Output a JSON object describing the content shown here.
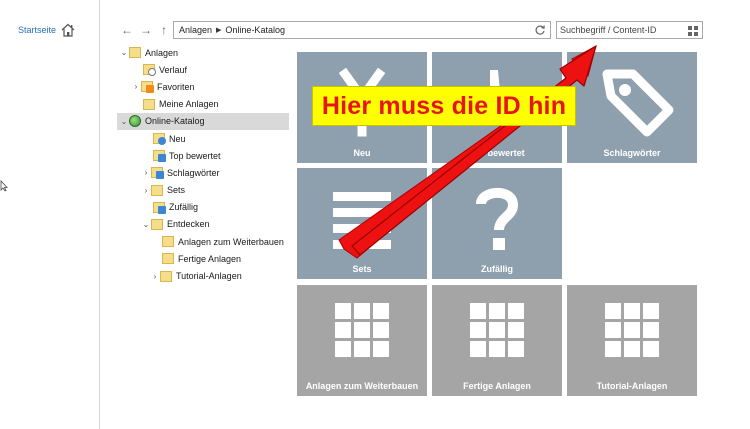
{
  "left_nav": {
    "startseite_label": "Startseite",
    "icon": "home-icon"
  },
  "toolbar": {
    "back": "←",
    "forward": "→",
    "up": "↑",
    "breadcrumb": [
      "Anlagen",
      "Online-Katalog"
    ],
    "search_placeholder": "Suchbegriff / Content-ID"
  },
  "tree": [
    {
      "label": "Anlagen",
      "chevron": "v",
      "icon": "folder-icon"
    },
    {
      "label": "Verlauf",
      "chevron": "",
      "icon": "history-folder-icon"
    },
    {
      "label": "Favoriten",
      "chevron": ">",
      "icon": "favorites-folder-icon"
    },
    {
      "label": "Meine Anlagen",
      "chevron": "",
      "icon": "folder-icon"
    },
    {
      "label": "Online-Katalog",
      "chevron": "v",
      "icon": "globe-icon",
      "selected": true
    },
    {
      "label": "Neu",
      "chevron": "",
      "icon": "new-folder-icon"
    },
    {
      "label": "Top bewertet",
      "chevron": "",
      "icon": "thumbs-up-folder-icon"
    },
    {
      "label": "Schlagwörter",
      "chevron": ">",
      "icon": "tag-folder-icon"
    },
    {
      "label": "Sets",
      "chevron": ">",
      "icon": "folder-icon"
    },
    {
      "label": "Zufällig",
      "chevron": "",
      "icon": "random-folder-icon"
    },
    {
      "label": "Entdecken",
      "chevron": "v",
      "icon": "folder-icon"
    },
    {
      "label": "Anlagen zum Weiterbauen",
      "chevron": "",
      "icon": "folder-icon"
    },
    {
      "label": "Fertige Anlagen",
      "chevron": "",
      "icon": "folder-icon"
    },
    {
      "label": "Tutorial-Anlagen",
      "chevron": ">",
      "icon": "folder-icon"
    }
  ],
  "tiles": [
    {
      "label": "Neu",
      "icon": "sparkle-icon",
      "color": "#8e9fae"
    },
    {
      "label": "Top bewertet",
      "icon": "thumbs-up-icon",
      "color": "#8e9fae"
    },
    {
      "label": "Schlagwörter",
      "icon": "tag-icon",
      "color": "#8e9fae"
    },
    {
      "label": "Sets",
      "icon": "list-icon",
      "color": "#8e9fae"
    },
    {
      "label": "Zufällig",
      "icon": "question-icon",
      "color": "#8e9fae"
    },
    {
      "label": "Anlagen zum Weiterbauen",
      "icon": "grid-icon",
      "color": "#a5a5a5"
    },
    {
      "label": "Fertige Anlagen",
      "icon": "grid-icon",
      "color": "#a5a5a5"
    },
    {
      "label": "Tutorial-Anlagen",
      "icon": "grid-icon",
      "color": "#a5a5a5"
    }
  ],
  "annotation": {
    "text": "Hier muss die ID hin",
    "text_color": "#e8141b",
    "background": "#ffff00",
    "arrow_color": "#ee1111"
  }
}
